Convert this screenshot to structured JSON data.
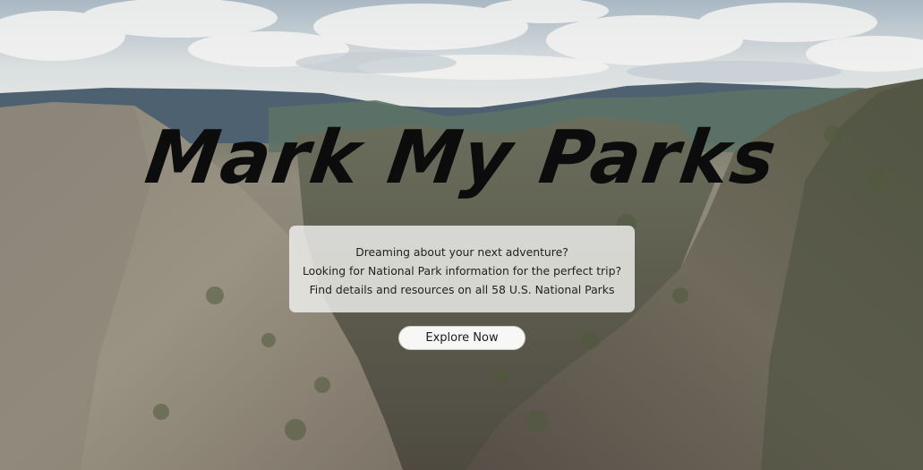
{
  "hero": {
    "title": "Mark My Parks",
    "description_lines": [
      "Dreaming about your next adventure?",
      "Looking for National Park information for the perfect trip?",
      "Find details and resources on all 58 U.S. National Parks"
    ],
    "cta_label": "Explore Now"
  }
}
